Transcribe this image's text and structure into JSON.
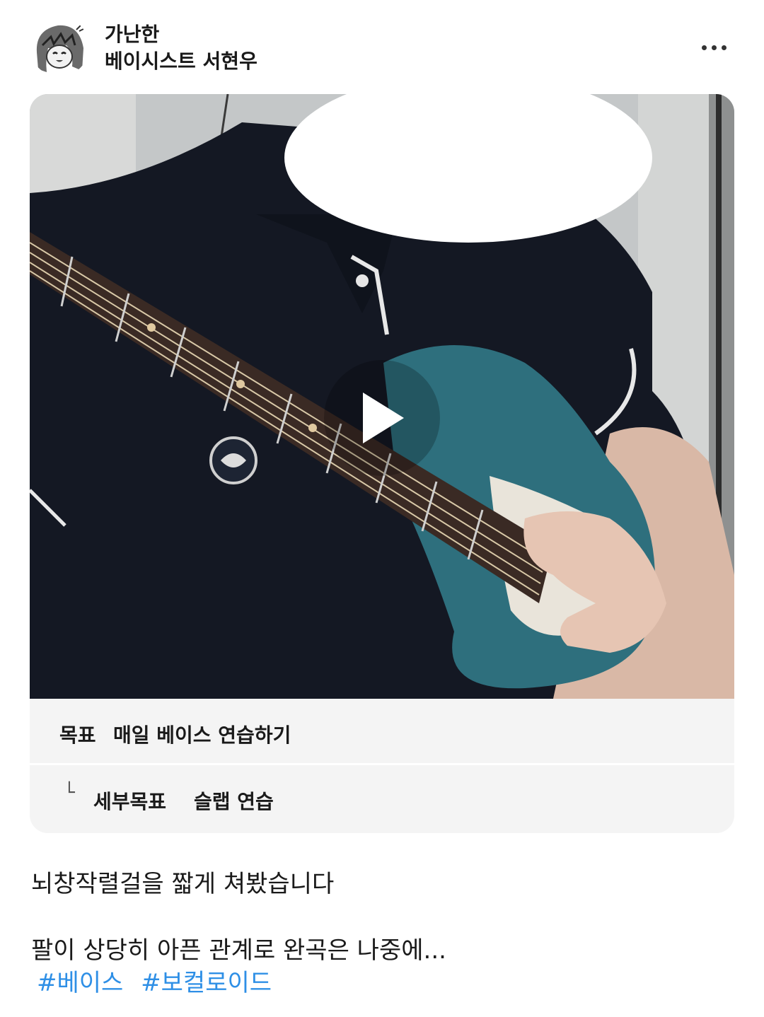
{
  "author": {
    "name_line1": "가난한",
    "name_line2": "베이시스트 서현우",
    "avatar_icon": "anime-girl-avatar"
  },
  "more_icon": "more-horizontal-icon",
  "video": {
    "description": "",
    "play_icon": "play-icon"
  },
  "goal": {
    "label": "목표",
    "text": "매일 베이스 연습하기"
  },
  "subgoal": {
    "icon": "└",
    "label": "세부목표",
    "text": "슬랩 연습"
  },
  "post": {
    "line1": "뇌창작렬걸을 짧게 쳐봤습니다",
    "line2": "팔이 상당히 아픈 관계로 완곡은 나중에...",
    "tags": [
      "#베이스",
      "#보컬로이드"
    ]
  },
  "colors": {
    "hashtag": "#2e8fe6",
    "card_bg": "#f4f4f4"
  }
}
